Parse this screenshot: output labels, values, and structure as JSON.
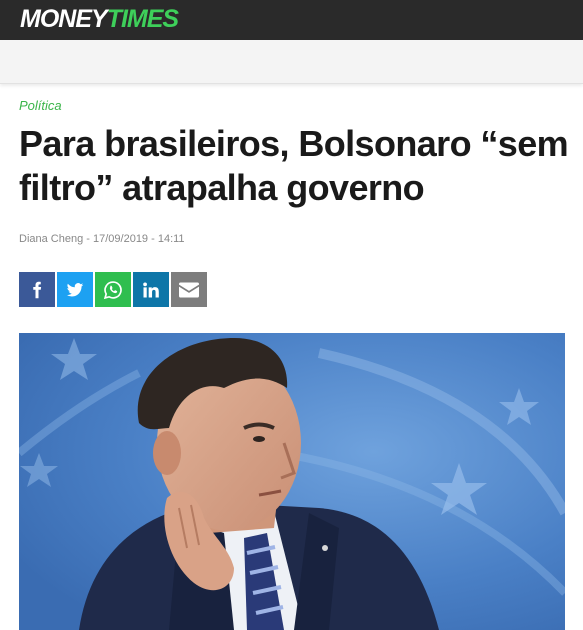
{
  "header": {
    "logo_part1": "MONEY",
    "logo_part2": "TIMES"
  },
  "colors": {
    "brand_green": "#3ecf5a",
    "category_green": "#3bb54a",
    "topbar_bg": "#2a2a2a",
    "facebook": "#3b5998",
    "twitter": "#1da1f2",
    "whatsapp": "#2fbe4f",
    "linkedin": "#0e76a8",
    "email": "#7d7d7d"
  },
  "article": {
    "category": "Política",
    "title": "Para brasileiros, Bolsonaro “sem filtro” atrapalha governo",
    "author": "Diana Cheng",
    "separator": " - ",
    "date": "17/09/2019",
    "time": "14:11"
  },
  "share": [
    {
      "network": "facebook",
      "icon": "facebook-icon"
    },
    {
      "network": "twitter",
      "icon": "twitter-icon"
    },
    {
      "network": "whatsapp",
      "icon": "whatsapp-icon"
    },
    {
      "network": "linkedin",
      "icon": "linkedin-icon"
    },
    {
      "network": "email",
      "icon": "email-icon"
    }
  ]
}
